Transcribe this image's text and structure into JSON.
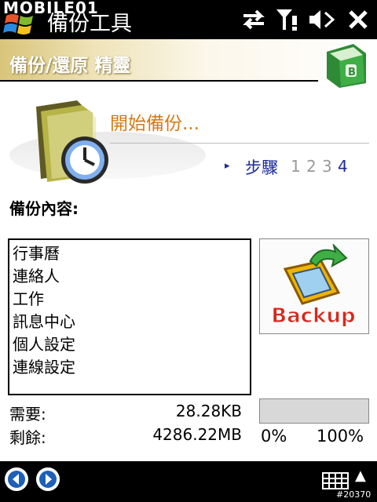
{
  "status_bar": {
    "app_title": "備份工具",
    "watermark": "MOBILE01",
    "icons": [
      "start-logo-icon",
      "sync-arrows-icon",
      "signal-alert-icon",
      "speaker-mute-icon",
      "close-icon"
    ]
  },
  "header": {
    "title": "備份/還原 精靈",
    "icon": "green-book-icon"
  },
  "wizard": {
    "status_text": "開始備份...",
    "step_label": "步驟",
    "steps": [
      "1",
      "2",
      "3",
      "4"
    ],
    "current_step": 4
  },
  "content": {
    "label": "備份內容:",
    "items": [
      "行事曆",
      "連絡人",
      "工作",
      "訊息中心",
      "個人設定",
      "連線設定"
    ]
  },
  "backup_button": {
    "label": "Backup",
    "icon": "pda-backup-icon"
  },
  "stats": {
    "required_label": "需要:",
    "required_value": "28.28KB",
    "remaining_label": "剩餘:",
    "remaining_value": "4286.22MB"
  },
  "progress": {
    "fraction": 0.0,
    "min_label": "0%",
    "max_label": "100%"
  },
  "bottom_bar": {
    "back_icon": "back-circle-icon",
    "forward_icon": "forward-circle-icon",
    "keyboard_icon": "keyboard-icon",
    "image_id": "#20370"
  },
  "colors": {
    "accent_orange": "#d77a17",
    "step_blue": "#1a2a9a",
    "bar_black": "#000000"
  }
}
